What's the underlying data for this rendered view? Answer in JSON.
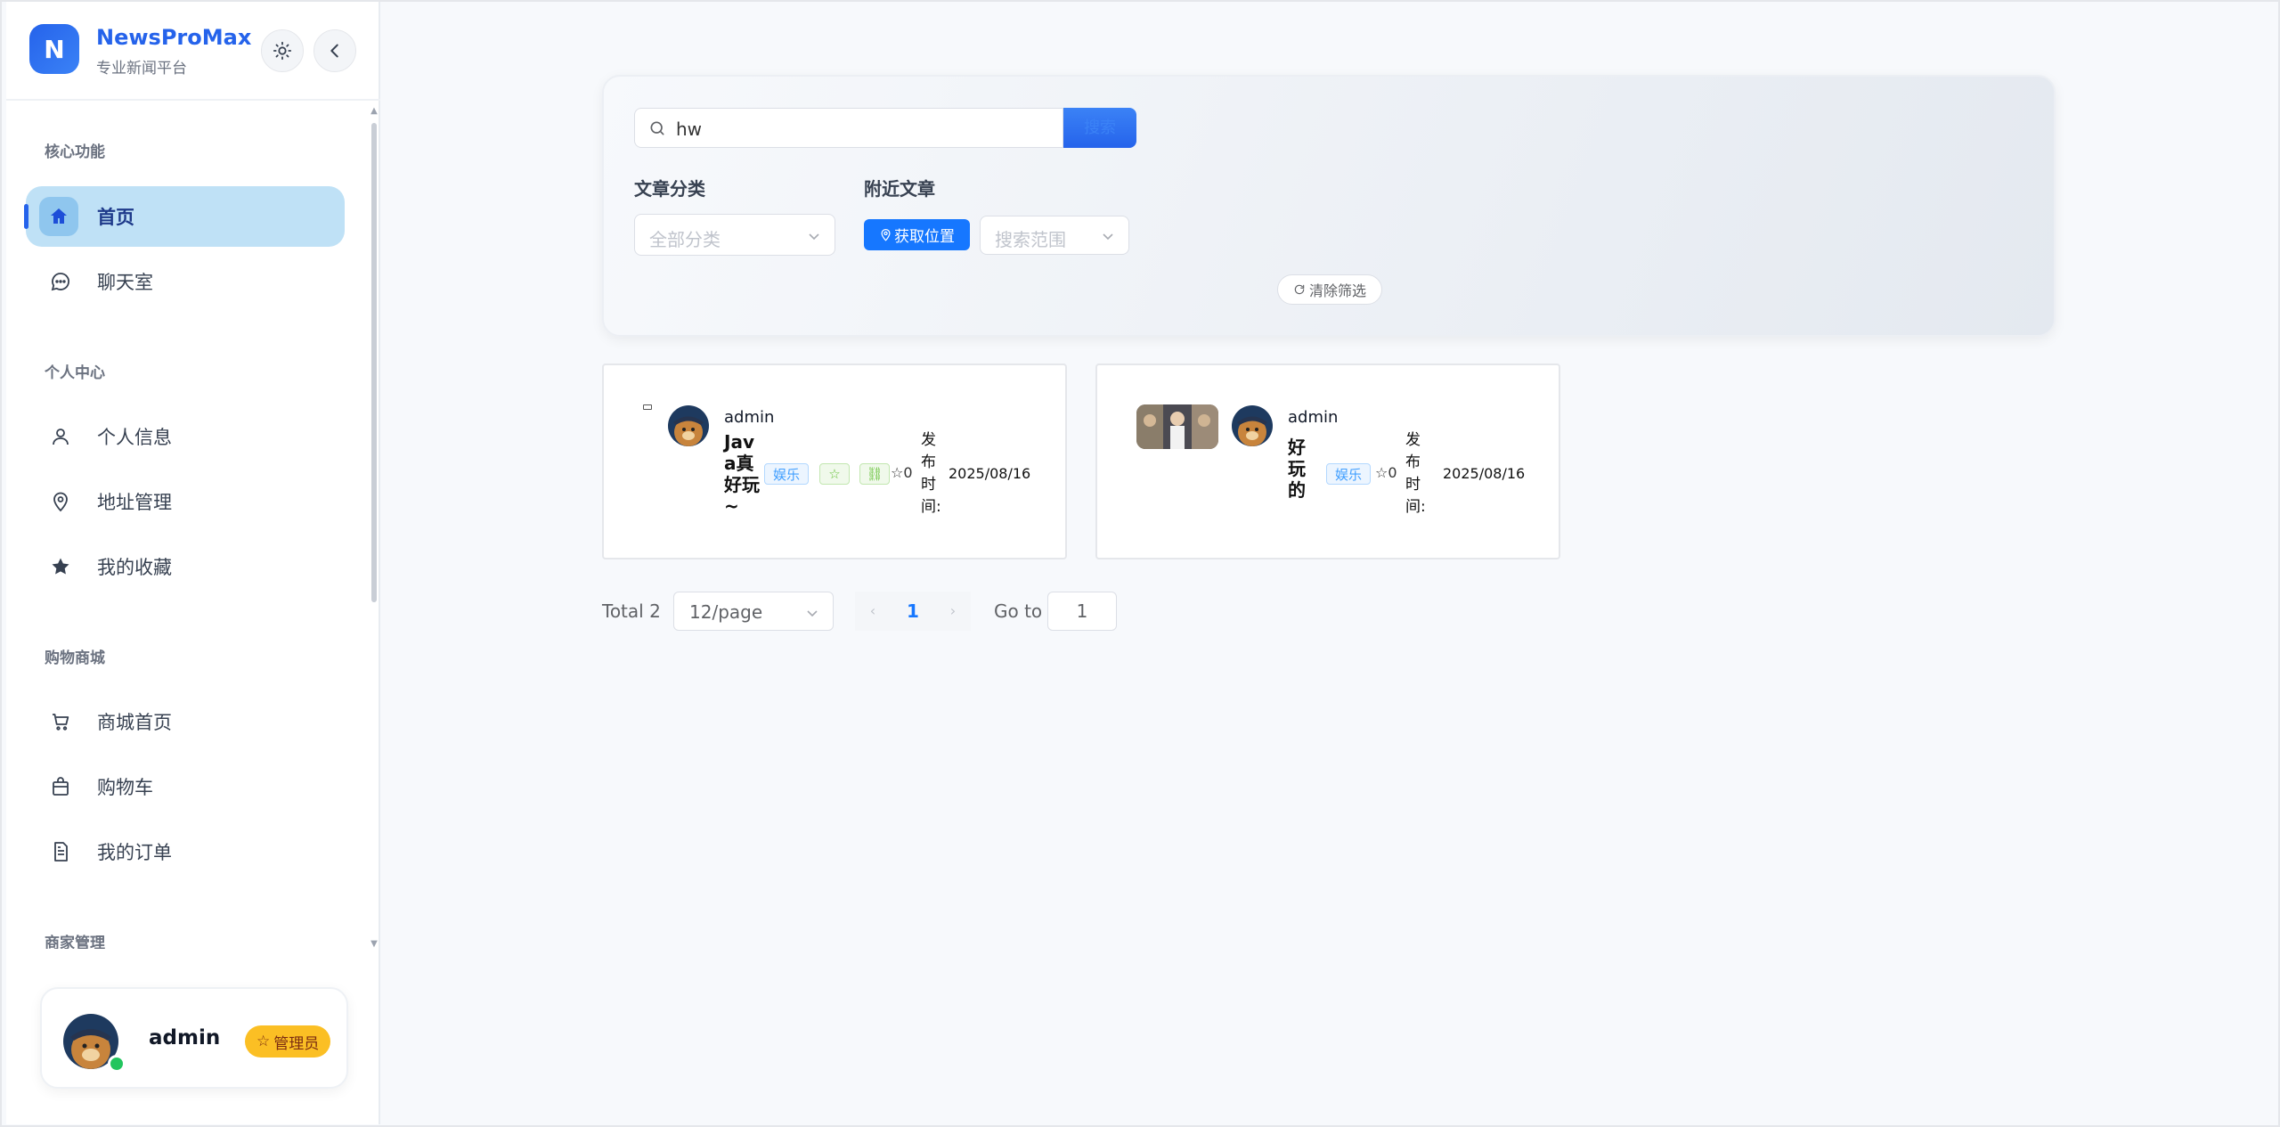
{
  "brand": {
    "logo_letter": "N",
    "name": "NewsProMax",
    "subtitle": "专业新闻平台"
  },
  "header_buttons": {
    "theme_icon": "sun-icon",
    "collapse_icon": "chevron-left-icon"
  },
  "sidebar": {
    "sections": {
      "core": "核心功能",
      "personal": "个人中心",
      "shop": "购物商城",
      "merchant": "商家管理"
    },
    "items": [
      {
        "label": "首页",
        "icon": "home-icon",
        "active": true
      },
      {
        "label": "聊天室",
        "icon": "chat-icon"
      },
      {
        "label": "个人信息",
        "icon": "user-icon"
      },
      {
        "label": "地址管理",
        "icon": "location-icon"
      },
      {
        "label": "我的收藏",
        "icon": "star-icon"
      },
      {
        "label": "商城首页",
        "icon": "cart-icon"
      },
      {
        "label": "购物车",
        "icon": "bag-icon"
      },
      {
        "label": "我的订单",
        "icon": "document-icon"
      }
    ]
  },
  "user": {
    "name": "admin",
    "role": "管理员",
    "status": "online"
  },
  "filters": {
    "search_value": "hw",
    "search_button": "搜索",
    "category_label": "文章分类",
    "category_placeholder": "全部分类",
    "nearby_label": "附近文章",
    "get_location": "获取位置",
    "range_placeholder": "搜索范围",
    "clear": "清除筛选"
  },
  "articles": [
    {
      "author": "admin",
      "title": "Java真好玩~",
      "tag": "娱乐",
      "stars": "0",
      "pub_label": "发布时间:",
      "date": "2025/08/16"
    },
    {
      "author": "admin",
      "title": "好玩的",
      "tag": "娱乐",
      "stars": "0",
      "pub_label": "发布时间:",
      "date": "2025/08/16"
    }
  ],
  "pagination": {
    "total": "Total 2",
    "page_size": "12/page",
    "current_page": "1",
    "goto_label": "Go to",
    "goto_value": "1"
  },
  "colors": {
    "primary": "#2563eb",
    "active_bg": "#bfe1f6",
    "badge": "#fbbf24",
    "online": "#22c55e"
  }
}
